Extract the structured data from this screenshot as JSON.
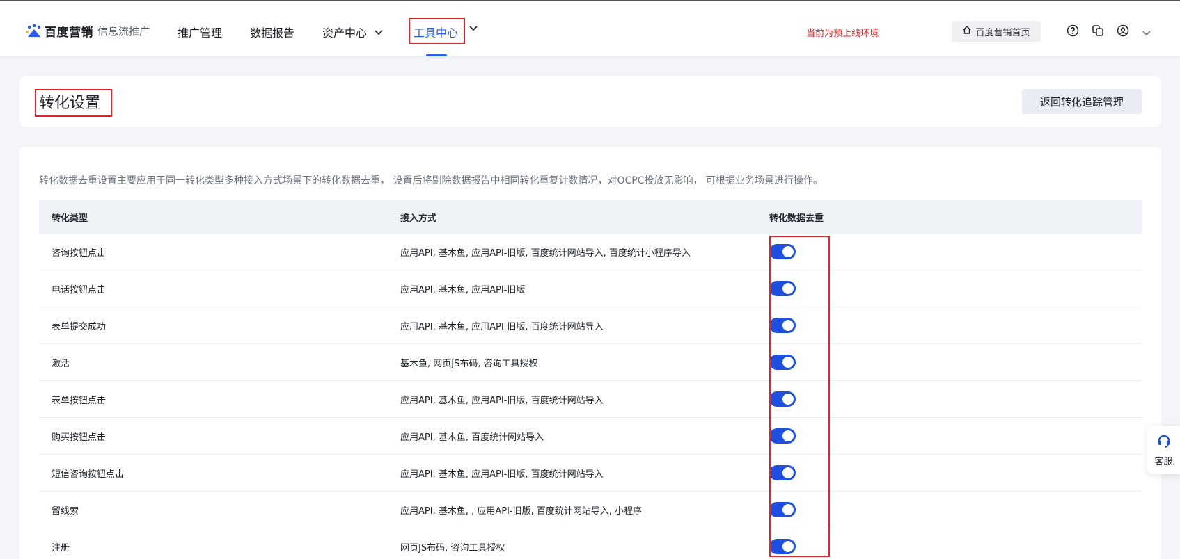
{
  "nav": {
    "brand": "百度营销",
    "product": "信息流推广",
    "items": [
      {
        "label": "推广管理"
      },
      {
        "label": "数据报告"
      },
      {
        "label": "资产中心"
      },
      {
        "label": "工具中心"
      }
    ],
    "env_notice": "当前为预上线环境",
    "home_label": "百度营销首页",
    "icons": [
      "help-icon",
      "copy-icon",
      "user-icon",
      "chevron-down-icon"
    ],
    "accent_color": "#2a5cf0"
  },
  "header": {
    "title": "转化设置",
    "back_label": "返回转化追踪管理"
  },
  "main": {
    "description": "转化数据去重设置主要应用于同一转化类型多种接入方式场景下的转化数据去重， 设置后将剔除数据报告中相同转化重复计数情况，对OCPC投放无影响， 可根据业务场景进行操作。",
    "columns": [
      "转化类型",
      "接入方式",
      "转化数据去重"
    ],
    "rows": [
      {
        "type": "咨询按钮点击",
        "access": "应用API, 基木鱼, 应用API-旧版, 百度统计网站导入, 百度统计小程序导入",
        "dedup": true
      },
      {
        "type": "电话按钮点击",
        "access": "应用API, 基木鱼, 应用API-旧版",
        "dedup": true
      },
      {
        "type": "表单提交成功",
        "access": "应用API, 基木鱼, 应用API-旧版, 百度统计网站导入",
        "dedup": true
      },
      {
        "type": "激活",
        "access": "基木鱼, 网页JS布码, 咨询工具授权",
        "dedup": true
      },
      {
        "type": "表单按钮点击",
        "access": "应用API, 基木鱼, 应用API-旧版, 百度统计网站导入",
        "dedup": true
      },
      {
        "type": "购买按钮点击",
        "access": "应用API, 基木鱼, 百度统计网站导入",
        "dedup": true
      },
      {
        "type": "短信咨询按钮点击",
        "access": "应用API, 基木鱼, 应用API-旧版, 百度统计网站导入",
        "dedup": true
      },
      {
        "type": "留线索",
        "access": "应用API, 基木鱼, , 应用API-旧版, 百度统计网站导入, 小程序",
        "dedup": true
      },
      {
        "type": "注册",
        "access": "网页JS布码, 咨询工具授权",
        "dedup": true
      }
    ],
    "toggle_color": "#1d4fe0"
  },
  "support": {
    "label": "客服",
    "icon": "headset-icon"
  }
}
